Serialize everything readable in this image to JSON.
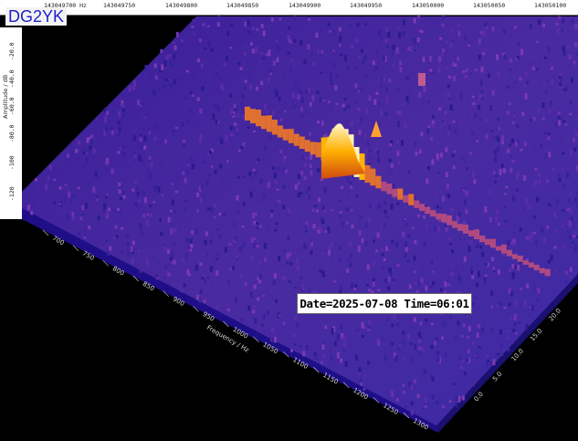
{
  "header": {
    "callsign": "DG2YK",
    "freq_unit_label": "143049700 Hz",
    "freq_labels": [
      "143049750",
      "143049800",
      "143049850",
      "143049900",
      "143049950",
      "143050000",
      "143050050",
      "143050100"
    ]
  },
  "amplitude_axis": {
    "title": "Amplitude / dB",
    "tick_labels": [
      "-20.0",
      "-40.0",
      "-60.0",
      "-80.0",
      "-100",
      "-120"
    ]
  },
  "audio_freq_axis": {
    "title": "Frequency / Hz",
    "tick_labels": [
      "700",
      "750",
      "800",
      "850",
      "900",
      "950",
      "1000",
      "1050",
      "1100",
      "1150",
      "1200",
      "1250",
      "1300"
    ]
  },
  "time_axis": {
    "tick_labels": [
      "0.0",
      "5.0",
      "10.0",
      "15.0",
      "20.0"
    ]
  },
  "stamp": {
    "text": "Date=2025-07-08 Time=06:01"
  },
  "colors": {
    "background": "#000000",
    "floor_dark": "#2a1a8e",
    "floor_mid": "#5b2ca6",
    "signal_peak": "#fff4b0",
    "signal_hot": "#ffb000",
    "callsign_text": "#1f22c8"
  }
}
